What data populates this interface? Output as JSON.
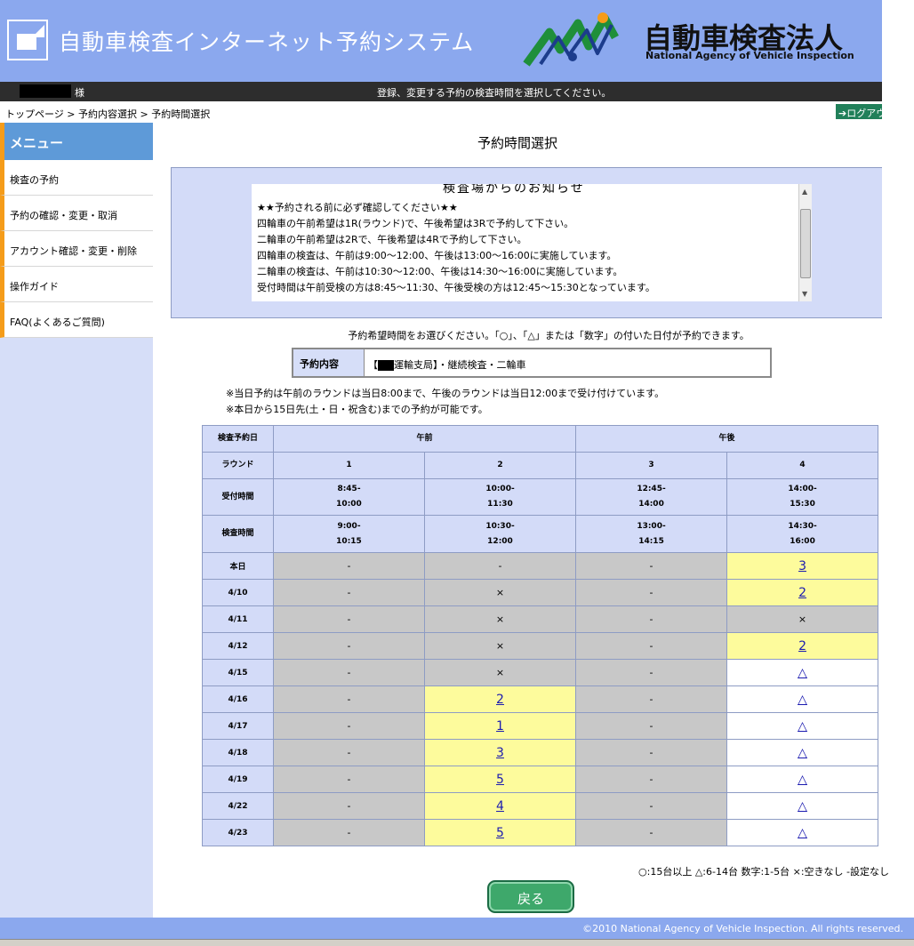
{
  "header": {
    "system_title": "自動車検査インターネット予約システム",
    "agency_name_ja": "自動車検査法人",
    "agency_name_en": "National Agency of Vehicle Inspection"
  },
  "topbar": {
    "user_suffix": "様",
    "instruction": "登録、変更する予約の検査時間を選択してください。"
  },
  "breadcrumb": "トップページ > 予約内容選択 > 予約時間選択",
  "logout_label": "ログアウト",
  "sidebar": {
    "heading": "メニュー",
    "items": [
      {
        "label": "検査の予約"
      },
      {
        "label": "予約の確認・変更・取消"
      },
      {
        "label": "アカウント確認・変更・削除"
      },
      {
        "label": "操作ガイド"
      },
      {
        "label": "FAQ(よくあるご質問)"
      }
    ]
  },
  "page_title": "予約時間選択",
  "notice": {
    "title": "検査場からのお知らせ",
    "lines": [
      "★★予約される前に必ず確認してください★★",
      "四輪車の午前希望は1R(ラウンド)で、午後希望は3Rで予約して下さい。",
      "二輪車の午前希望は2Rで、午後希望は4Rで予約して下さい。",
      "四輪車の検査は、午前は9:00～12:00、午後は13:00～16:00に実施しています。",
      "二輪車の検査は、午前は10:30～12:00、午後は14:30～16:00に実施しています。",
      "受付時間は午前受検の方は8:45～11:30、午後受検の方は12:45～15:30となっています。"
    ]
  },
  "choose_text": "予約希望時間をお選びください。「○」、「△」または「数字」の付いた日付が予約できます。",
  "content": {
    "label": "予約内容",
    "prefix": "【",
    "value": "運輸支局】・継続検査・二輪車"
  },
  "notes": [
    "※当日予約は午前のラウンドは当日8:00まで、午後のラウンドは当日12:00まで受け付けています。",
    "※本日から15日先(土・日・祝含む)までの予約が可能です。"
  ],
  "table": {
    "date_header": "検査予約日",
    "am": "午前",
    "pm": "午後",
    "round_label": "ラウンド",
    "reception_label": "受付時間",
    "inspection_label": "検査時間",
    "rounds": [
      "1",
      "2",
      "3",
      "4"
    ],
    "reception": [
      [
        "8:45-",
        "10:00"
      ],
      [
        "10:00-",
        "11:30"
      ],
      [
        "12:45-",
        "14:00"
      ],
      [
        "14:00-",
        "15:30"
      ]
    ],
    "inspection": [
      [
        "9:00-",
        "10:15"
      ],
      [
        "10:30-",
        "12:00"
      ],
      [
        "13:00-",
        "14:15"
      ],
      [
        "14:30-",
        "16:00"
      ]
    ],
    "rows": [
      {
        "date": "本日",
        "cells": [
          [
            "-",
            "na"
          ],
          [
            "-",
            "na"
          ],
          [
            "-",
            "na"
          ],
          [
            "3",
            "avail"
          ]
        ]
      },
      {
        "date": "4/10",
        "cells": [
          [
            "-",
            "na"
          ],
          [
            "×",
            "na"
          ],
          [
            "-",
            "na"
          ],
          [
            "2",
            "avail"
          ]
        ]
      },
      {
        "date": "4/11",
        "cells": [
          [
            "-",
            "na"
          ],
          [
            "×",
            "na"
          ],
          [
            "-",
            "na"
          ],
          [
            "×",
            "na"
          ]
        ]
      },
      {
        "date": "4/12",
        "cells": [
          [
            "-",
            "na"
          ],
          [
            "×",
            "na"
          ],
          [
            "-",
            "na"
          ],
          [
            "2",
            "avail"
          ]
        ]
      },
      {
        "date": "4/15",
        "cells": [
          [
            "-",
            "na"
          ],
          [
            "×",
            "na"
          ],
          [
            "-",
            "na"
          ],
          [
            "△",
            "open"
          ]
        ]
      },
      {
        "date": "4/16",
        "cells": [
          [
            "-",
            "na"
          ],
          [
            "2",
            "avail"
          ],
          [
            "-",
            "na"
          ],
          [
            "△",
            "open"
          ]
        ]
      },
      {
        "date": "4/17",
        "cells": [
          [
            "-",
            "na"
          ],
          [
            "1",
            "avail"
          ],
          [
            "-",
            "na"
          ],
          [
            "△",
            "open"
          ]
        ]
      },
      {
        "date": "4/18",
        "cells": [
          [
            "-",
            "na"
          ],
          [
            "3",
            "avail"
          ],
          [
            "-",
            "na"
          ],
          [
            "△",
            "open"
          ]
        ]
      },
      {
        "date": "4/19",
        "cells": [
          [
            "-",
            "na"
          ],
          [
            "5",
            "avail"
          ],
          [
            "-",
            "na"
          ],
          [
            "△",
            "open"
          ]
        ]
      },
      {
        "date": "4/22",
        "cells": [
          [
            "-",
            "na"
          ],
          [
            "4",
            "avail"
          ],
          [
            "-",
            "na"
          ],
          [
            "△",
            "open"
          ]
        ]
      },
      {
        "date": "4/23",
        "cells": [
          [
            "-",
            "na"
          ],
          [
            "5",
            "avail"
          ],
          [
            "-",
            "na"
          ],
          [
            "△",
            "open"
          ]
        ]
      }
    ]
  },
  "legend": "○:15台以上 △:6-14台 数字:1-5台 ×:空きなし -設定なし",
  "back_label": "戻る",
  "copyright": "©2010 National Agency of Vehicle Inspection. All rights reserved.",
  "colors": {
    "header": "#8ba8ee",
    "menu_head": "#5e9ad8",
    "menu_accent": "#f59c1a",
    "available": "#fdfb9c",
    "unavailable": "#c8c8c8",
    "table_header": "#d3dbf8",
    "back_button": "#3ea86b"
  }
}
